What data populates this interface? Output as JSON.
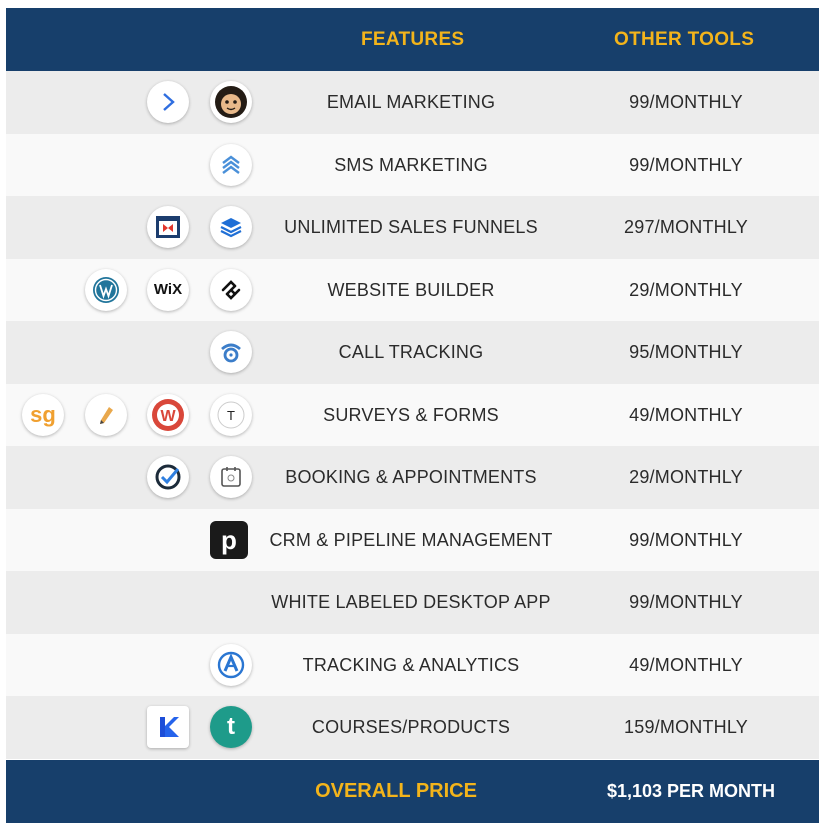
{
  "header": {
    "features_label": "FEATURES",
    "other_tools_label": "OTHER TOOLS"
  },
  "rows": [
    {
      "feature": "EMAIL MARKETING",
      "price": "99/MONTHLY",
      "icons": [
        "activecampaign-icon",
        "mailchimp-icon"
      ]
    },
    {
      "feature": "SMS MARKETING",
      "price": "99/MONTHLY",
      "icons": [
        "chevrons-up-icon"
      ]
    },
    {
      "feature": "UNLIMITED SALES FUNNELS",
      "price": "297/MONTHLY",
      "icons": [
        "clickfunnels-icon",
        "layers-icon"
      ]
    },
    {
      "feature": "WEBSITE BUILDER",
      "price": "29/MONTHLY",
      "icons": [
        "wordpress-icon",
        "wix-icon",
        "squarespace-icon"
      ]
    },
    {
      "feature": "CALL TRACKING",
      "price": "95/MONTHLY",
      "icons": [
        "call-tracking-icon"
      ]
    },
    {
      "feature": "SURVEYS & FORMS",
      "price": "49/MONTHLY",
      "icons": [
        "surveygizmo-icon",
        "pencil-icon",
        "wufoo-icon",
        "typeform-icon"
      ]
    },
    {
      "feature": "BOOKING & APPOINTMENTS",
      "price": "29/MONTHLY",
      "icons": [
        "check-circle-icon",
        "calendar-icon"
      ]
    },
    {
      "feature": "CRM & PIPELINE MANAGEMENT",
      "price": "99/MONTHLY",
      "icons": [
        "pipedrive-icon"
      ]
    },
    {
      "feature": "WHITE LABELED DESKTOP APP",
      "price": "99/MONTHLY",
      "icons": []
    },
    {
      "feature": "TRACKING & ANALYTICS",
      "price": "49/MONTHLY",
      "icons": [
        "analytics-icon"
      ]
    },
    {
      "feature": "COURSES/PRODUCTS",
      "price": "159/MONTHLY",
      "icons": [
        "kajabi-icon",
        "teachable-icon"
      ]
    }
  ],
  "icon_text": {
    "wix": "WiX",
    "surveygizmo": "sg",
    "wufoo": "W",
    "typeform": "T",
    "pipedrive": "p",
    "teachable": "t"
  },
  "footer": {
    "label": "OVERALL PRICE",
    "total": "$1,103 PER MONTH"
  },
  "colors": {
    "header_bg": "#173f6b",
    "accent": "#f3b41b",
    "row_odd": "#ececec",
    "row_even": "#f9f9f9"
  }
}
